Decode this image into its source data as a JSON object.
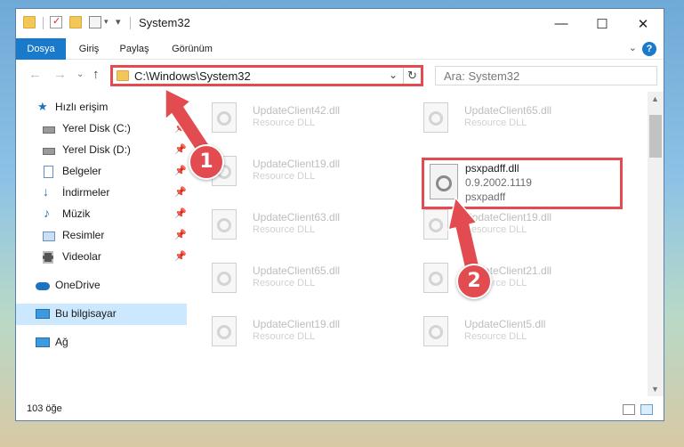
{
  "window": {
    "title": "System32",
    "controls": {
      "minimize": "—",
      "maximize": "☐",
      "close": "✕"
    }
  },
  "ribbon": {
    "tabs": [
      "Dosya",
      "Giriş",
      "Paylaş",
      "Görünüm"
    ],
    "help": "?"
  },
  "address": {
    "path": "C:\\Windows\\System32",
    "search_placeholder": "Ara: System32"
  },
  "sidebar": {
    "items": [
      {
        "label": "Hızlı erişim",
        "icon": "star-icon",
        "pinned": false
      },
      {
        "label": "Yerel Disk (C:)",
        "icon": "drive-icon",
        "pinned": true
      },
      {
        "label": "Yerel Disk (D:)",
        "icon": "drive-icon",
        "pinned": true
      },
      {
        "label": "Belgeler",
        "icon": "documents-icon",
        "pinned": true
      },
      {
        "label": "İndirmeler",
        "icon": "download-icon",
        "pinned": true
      },
      {
        "label": "Müzik",
        "icon": "music-icon",
        "pinned": true
      },
      {
        "label": "Resimler",
        "icon": "pictures-icon",
        "pinned": true
      },
      {
        "label": "Videolar",
        "icon": "videos-icon",
        "pinned": true
      },
      {
        "label": "OneDrive",
        "icon": "cloud-icon",
        "pinned": false
      },
      {
        "label": "Bu bilgisayar",
        "icon": "computer-icon",
        "pinned": false,
        "selected": true
      },
      {
        "label": "Ağ",
        "icon": "network-icon",
        "pinned": false
      }
    ]
  },
  "files": {
    "left_column": [
      {
        "name": "UpdateClient42.dll",
        "type": "Resource DLL"
      },
      {
        "name": "UpdateClient19.dll",
        "type": "Resource DLL"
      },
      {
        "name": "UpdateClient63.dll",
        "type": "Resource DLL"
      },
      {
        "name": "UpdateClient65.dll",
        "type": "Resource DLL"
      },
      {
        "name": "UpdateClient19.dll",
        "type": "Resource DLL"
      }
    ],
    "right_column": [
      {
        "name": "UpdateClient65.dll",
        "type": "Resource DLL"
      },
      {
        "name": "UpdateClient19.dll",
        "type": "Resource DLL"
      },
      {
        "name": "UpdateClient21.dll",
        "type": "Resource DLL"
      },
      {
        "name": "UpdateClient5.dll",
        "type": "Resource DLL"
      }
    ],
    "highlighted": {
      "name": "psxpadff.dll",
      "version": "0.9.2002.1119",
      "description": "psxpadff"
    }
  },
  "status": {
    "count": "103 öğe"
  },
  "callouts": {
    "step1": "1",
    "step2": "2",
    "color": "#e24b4f"
  }
}
